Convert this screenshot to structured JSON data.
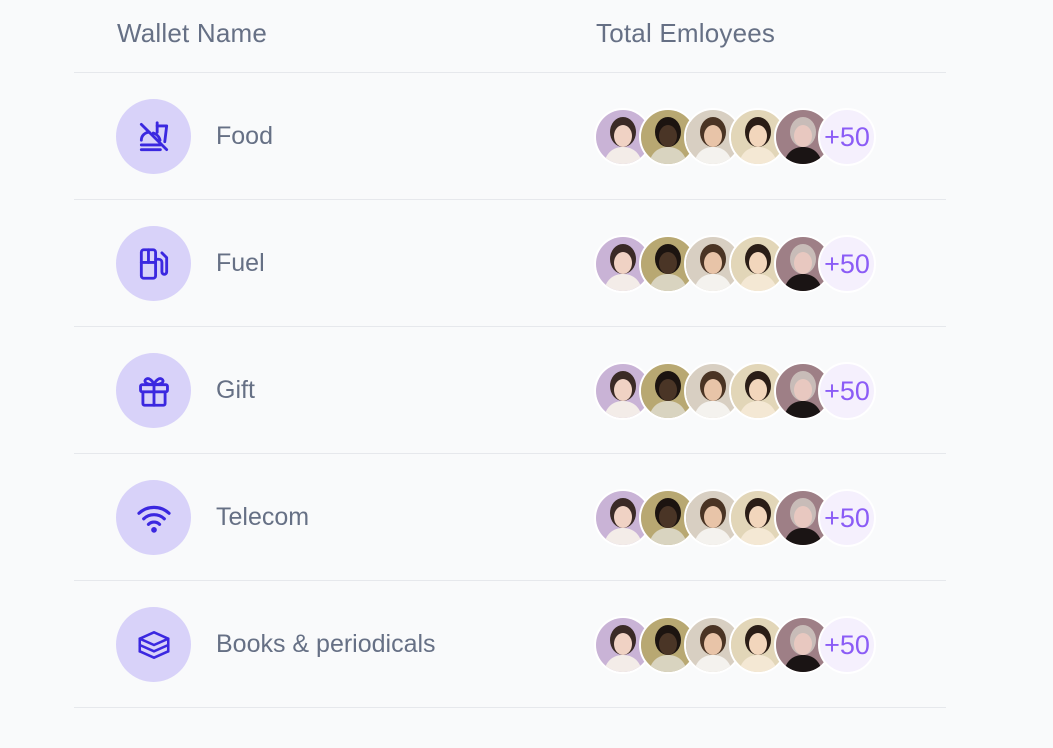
{
  "header": {
    "wallet_name": "Wallet Name",
    "total_employees": "Total Emloyees"
  },
  "colors": {
    "icon_bg": "#d8d2f9",
    "icon_fg": "#3b28e0",
    "more_bg": "#f5f0fd",
    "more_fg": "#8b5cf6",
    "text": "#667085",
    "divider": "#e6e8ec"
  },
  "wallets": [
    {
      "icon": "no-food-icon",
      "label": "Food",
      "more": "+50"
    },
    {
      "icon": "fuel-pump-icon",
      "label": "Fuel",
      "more": "+50"
    },
    {
      "icon": "gift-icon",
      "label": "Gift",
      "more": "+50"
    },
    {
      "icon": "wifi-icon",
      "label": "Telecom",
      "more": "+50"
    },
    {
      "icon": "layers-icon",
      "label": "Books & periodicals",
      "more": "+50"
    }
  ],
  "avatars": [
    {
      "name": "avatar-woman-1",
      "bg": "#c9b3d6",
      "skin": "#f0d2c4",
      "hair": "#3a2a26",
      "shirt": "#f3ece8"
    },
    {
      "name": "avatar-man-1",
      "bg": "#b8a872",
      "skin": "#4a3526",
      "hair": "#1c1410",
      "shirt": "#d9d4c0"
    },
    {
      "name": "avatar-man-2",
      "bg": "#d8cfc2",
      "skin": "#e8c4a8",
      "hair": "#4a3424",
      "shirt": "#f4f2ee"
    },
    {
      "name": "avatar-woman-2",
      "bg": "#e2d6b8",
      "skin": "#f2d6bc",
      "hair": "#2a1d16",
      "shirt": "#f4e8d4"
    },
    {
      "name": "avatar-woman-3",
      "bg": "#9e7f86",
      "skin": "#e8c8c0",
      "hair": "#c8bcb8",
      "shirt": "#1a1414"
    }
  ]
}
